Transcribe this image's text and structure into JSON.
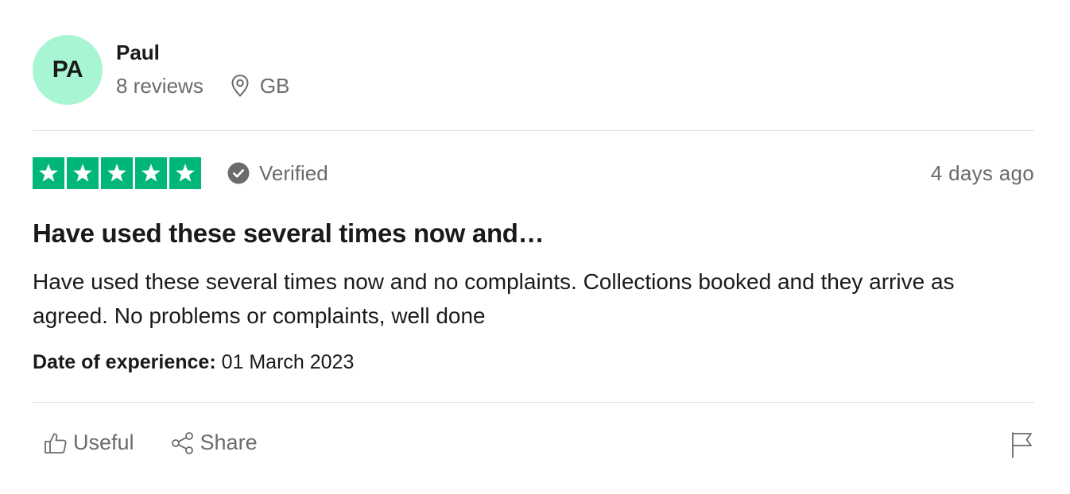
{
  "reviewer": {
    "initials": "PA",
    "name": "Paul",
    "review_count": "8 reviews",
    "location": "GB"
  },
  "review": {
    "rating": 5,
    "verified_label": "Verified",
    "posted": "4 days ago",
    "title": "Have used these several times now and…",
    "body": "Have used these several times now and no complaints. Collections booked and they arrive as agreed. No problems or complaints, well done",
    "experience_label": "Date of experience:",
    "experience_date": "01 March 2023"
  },
  "actions": {
    "useful_label": "Useful",
    "share_label": "Share"
  },
  "colors": {
    "avatar_bg": "#a8f5d3",
    "star_green": "#00b67a",
    "muted_text": "#6b6b6b",
    "divider": "#dcdce3"
  },
  "icons": {
    "location": "map-pin-icon",
    "verified": "check-circle-icon",
    "useful": "thumbs-up-icon",
    "share": "share-icon",
    "report": "flag-icon"
  }
}
